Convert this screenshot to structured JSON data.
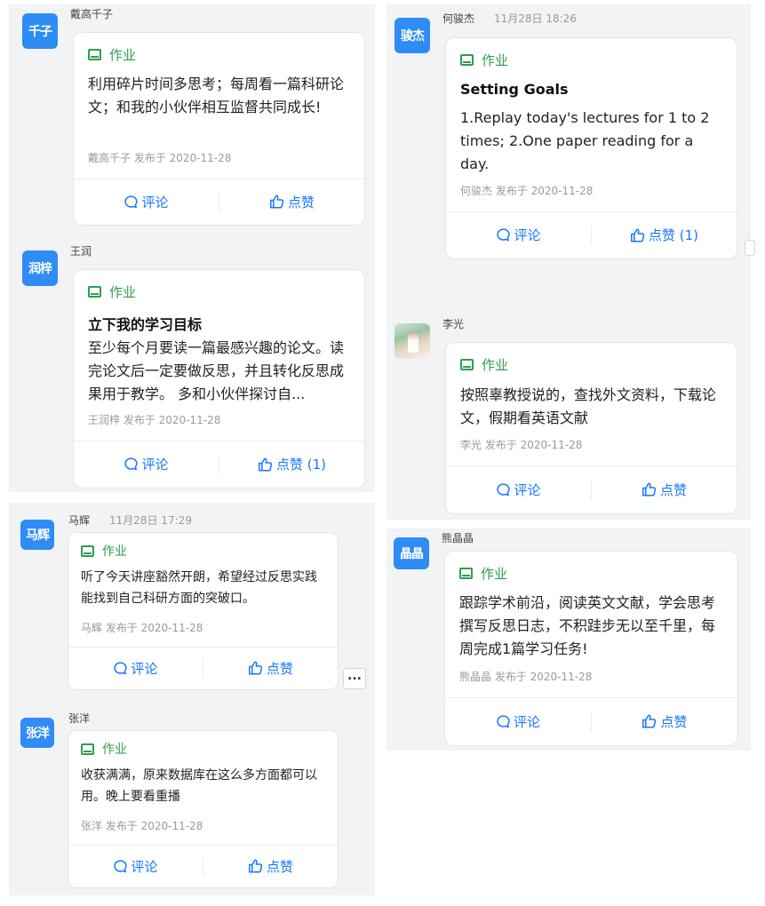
{
  "common": {
    "tag_label": "作业",
    "comment_label": "评论",
    "like_label": "点赞"
  },
  "posts": [
    {
      "avatar": "千子",
      "author": "戴高千子",
      "time": "",
      "title": "",
      "body": "利用碎片时间多思考；每周看一篇科研论文；和我的小伙伴相互监督共同成长!",
      "byline": "戴高千子 发布于 2020-11-28",
      "like_label": "点赞"
    },
    {
      "avatar": "润梓",
      "author": "王润",
      "time": "",
      "title": "立下我的学习目标",
      "body": "至少每个月要读一篇最感兴趣的论文。读完论文后一定要做反思，并且转化反思成果用于教学。 多和小伙伴探讨自...",
      "byline": "王润梓 发布于 2020-11-28",
      "like_label": "点赞 (1)"
    },
    {
      "avatar": "骏杰",
      "author": "何骏杰",
      "time": "11月28日 18:26",
      "title": "Setting Goals",
      "body": "1.Replay today's lectures for 1 to 2 times; 2.One paper reading for a day.",
      "byline": "何骏杰 发布于 2020-11-28",
      "like_label": "点赞 (1)"
    },
    {
      "avatar": "",
      "author": "李光",
      "time": "",
      "title": "",
      "body": "按照辜教授说的，查找外文资料，下载论文，假期看英语文献",
      "byline": "李光 发布于 2020-11-28",
      "like_label": "点赞"
    },
    {
      "avatar": "马辉",
      "author": "马辉",
      "time": "11月28日 17:29",
      "title": "",
      "body": "听了今天讲座豁然开朗，希望经过反思实践能找到自己科研方面的突破口。",
      "byline": "马辉 发布于 2020-11-28",
      "like_label": "点赞"
    },
    {
      "avatar": "晶晶",
      "author": "熊晶晶",
      "time": "",
      "title": "",
      "body": "跟踪学术前沿，阅读英文文献，学会思考撰写反思日志，不积跬步无以至千里，每周完成1篇学习任务!",
      "byline": "熊晶晶 发布于 2020-11-28",
      "like_label": "点赞"
    },
    {
      "avatar": "张洋",
      "author": "张洋",
      "time": "",
      "title": "",
      "body": "收获满满，原来数据库在这么多方面都可以用。晚上要看重播",
      "byline": "张洋 发布于 2020-11-28",
      "like_label": "点赞"
    }
  ],
  "more_button_label": "..."
}
